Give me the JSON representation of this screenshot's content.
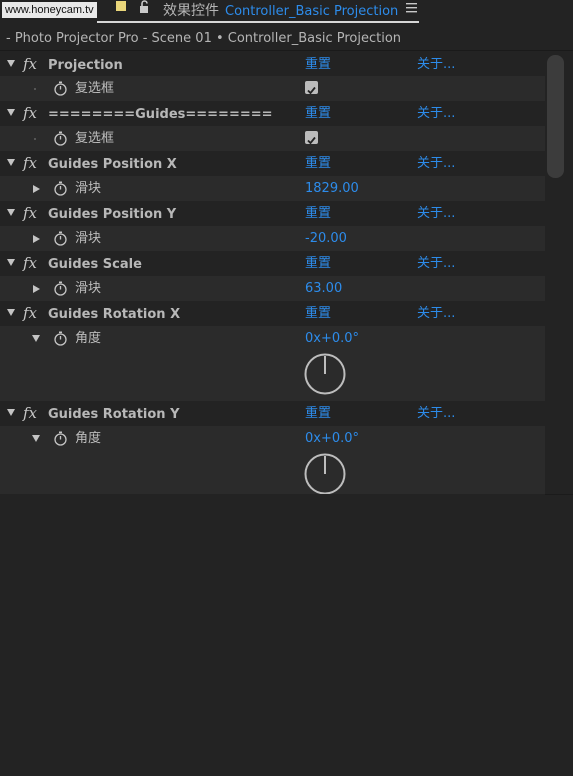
{
  "watermark": "www.honeycam.tv",
  "panel": {
    "tab_prefix": "效果控件",
    "tab_layer": "Controller_Basic Projection",
    "breadcrumb": "- Photo Projector Pro - Scene 01 • Controller_Basic Projection"
  },
  "colors": {
    "accent": "#2d8ceb",
    "background": "#232323",
    "property_row": "#2b2b2b",
    "label_chip": "#e9d67a"
  },
  "effects": [
    {
      "name": "Projection",
      "reset": "重置",
      "about": "关于...",
      "property": {
        "name": "复选框",
        "type": "checkbox",
        "checked": true
      }
    },
    {
      "name": "========Guides========",
      "reset": "重置",
      "about": "关于...",
      "property": {
        "name": "复选框",
        "type": "checkbox",
        "checked": true
      }
    },
    {
      "name": "Guides Position X",
      "reset": "重置",
      "about": "关于...",
      "property": {
        "name": "滑块",
        "type": "slider",
        "value": "1829.00"
      }
    },
    {
      "name": "Guides Position Y",
      "reset": "重置",
      "about": "关于...",
      "property": {
        "name": "滑块",
        "type": "slider",
        "value": "-20.00"
      }
    },
    {
      "name": "Guides Scale",
      "reset": "重置",
      "about": "关于...",
      "property": {
        "name": "滑块",
        "type": "slider",
        "value": "63.00"
      }
    },
    {
      "name": "Guides Rotation X",
      "reset": "重置",
      "about": "关于...",
      "property": {
        "name": "角度",
        "type": "angle",
        "value": "0x+0.0°"
      }
    },
    {
      "name": "Guides Rotation Y",
      "reset": "重置",
      "about": "关于...",
      "property": {
        "name": "角度",
        "type": "angle",
        "value": "0x+0.0°"
      }
    }
  ]
}
